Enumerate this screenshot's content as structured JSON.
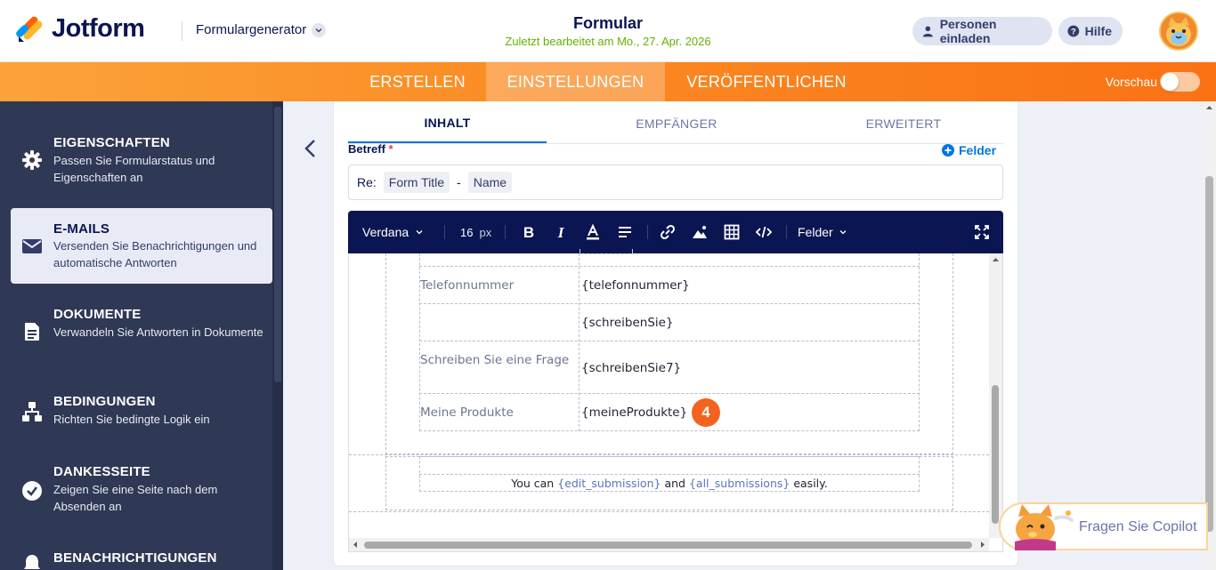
{
  "header": {
    "brand": "Jotform",
    "builder_label": "Formulargenerator",
    "form_title": "Formular",
    "last_edited": "Zuletzt bearbeitet am Mo., 27. Apr. 2026",
    "invite_label": "Personen einladen",
    "help_label": "Hilfe"
  },
  "nav": {
    "tabs": [
      "ERSTELLEN",
      "EINSTELLUNGEN",
      "VERÖFFENTLICHEN"
    ],
    "active_tab": "EINSTELLUNGEN",
    "preview_label": "Vorschau",
    "preview_on": false
  },
  "sidebar": {
    "items": [
      {
        "title": "EIGENSCHAFTEN",
        "desc": "Passen Sie Formularstatus und Eigenschaften an",
        "icon": "gear-icon"
      },
      {
        "title": "E-MAILS",
        "desc": "Versenden Sie Benachrichtigungen und automatische Antworten",
        "icon": "envelope-icon",
        "active": true
      },
      {
        "title": "DOKUMENTE",
        "desc": "Verwandeln Sie Antworten in Dokumente",
        "icon": "document-icon"
      },
      {
        "title": "BEDINGUNGEN",
        "desc": "Richten Sie bedingte Logik ein",
        "icon": "hierarchy-icon"
      },
      {
        "title": "DANKESSEITE",
        "desc": "Zeigen Sie eine Seite nach dem Absenden an",
        "icon": "check-circle-icon"
      },
      {
        "title": "BENACHRICHTIGUNGEN",
        "desc": "",
        "icon": "bell-icon"
      }
    ]
  },
  "email_editor": {
    "tabs": [
      "INHALT",
      "EMPFÄNGER",
      "ERWEITERT"
    ],
    "active_tab": "INHALT",
    "subject_label": "Betreff",
    "required_mark": "*",
    "felder_link": "Felder",
    "subject": {
      "prefix": "Re:",
      "tags": [
        "Form Title",
        "Name"
      ],
      "separator": "-"
    },
    "toolbar": {
      "font": "Verdana",
      "size_value": "16",
      "size_unit": "px",
      "fields_label": "Felder"
    },
    "table_rows": [
      {
        "label": "Telefonnummer",
        "value": "{telefonnummer}"
      },
      {
        "label": "",
        "value": "{schreibenSie}"
      },
      {
        "label": "Schreiben Sie eine Frage",
        "value": "{schreibenSie7}"
      },
      {
        "label": "Meine Produkte",
        "value": "{meineProdukte}"
      }
    ],
    "step_badge": "4",
    "footer": {
      "pre": "You can",
      "var1": "{edit_submission}",
      "mid": "and",
      "var2": "{all_submissions}",
      "post": "easily."
    }
  },
  "copilot": {
    "label": "Fragen Sie Copilot"
  },
  "colors": {
    "navy": "#0a1551",
    "orange": "#fa7214",
    "accent_blue": "#0075e3",
    "green": "#64b100",
    "sidebar_bg": "#2f3854",
    "badge": "#f3621e"
  }
}
